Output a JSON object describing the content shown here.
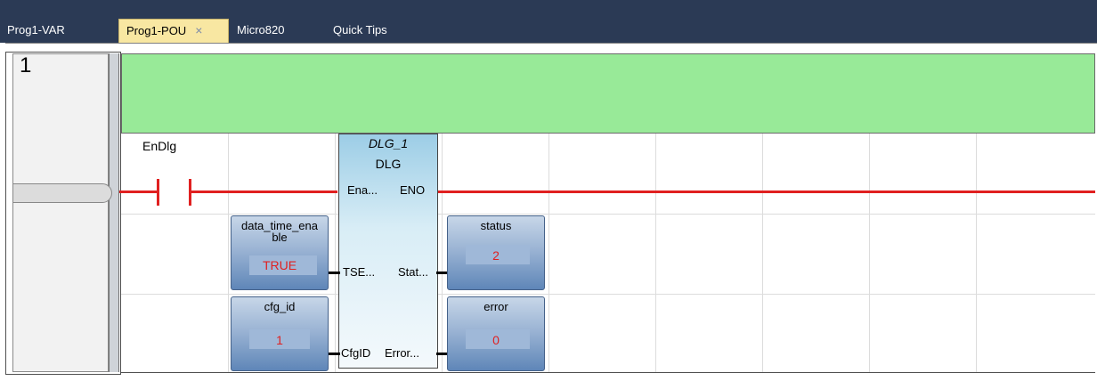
{
  "tabs": [
    {
      "label": "Prog1-VAR"
    },
    {
      "label": "Prog1-POU",
      "close": "×"
    },
    {
      "label": "Micro820"
    },
    {
      "label": "Quick Tips"
    }
  ],
  "rung": {
    "number": "1"
  },
  "contact": {
    "label": "EnDlg"
  },
  "function_block": {
    "instance": "DLG_1",
    "type": "DLG",
    "inputs": [
      "Ena...",
      "TSE...",
      "CfgID"
    ],
    "outputs": [
      "ENO",
      "Stat...",
      "Error..."
    ]
  },
  "variables": {
    "data_time_enable": {
      "name": "data_time_ena\nble",
      "value": "TRUE"
    },
    "cfg_id": {
      "name": "cfg_id",
      "value": "1"
    },
    "status": {
      "name": "status",
      "value": "2"
    },
    "error": {
      "name": "error",
      "value": "0"
    }
  },
  "colors": {
    "comment_bg": "#98ea98",
    "wire": "#e02020",
    "active_tab": "#f8e7a2",
    "tabbar": "#2b3a55"
  }
}
